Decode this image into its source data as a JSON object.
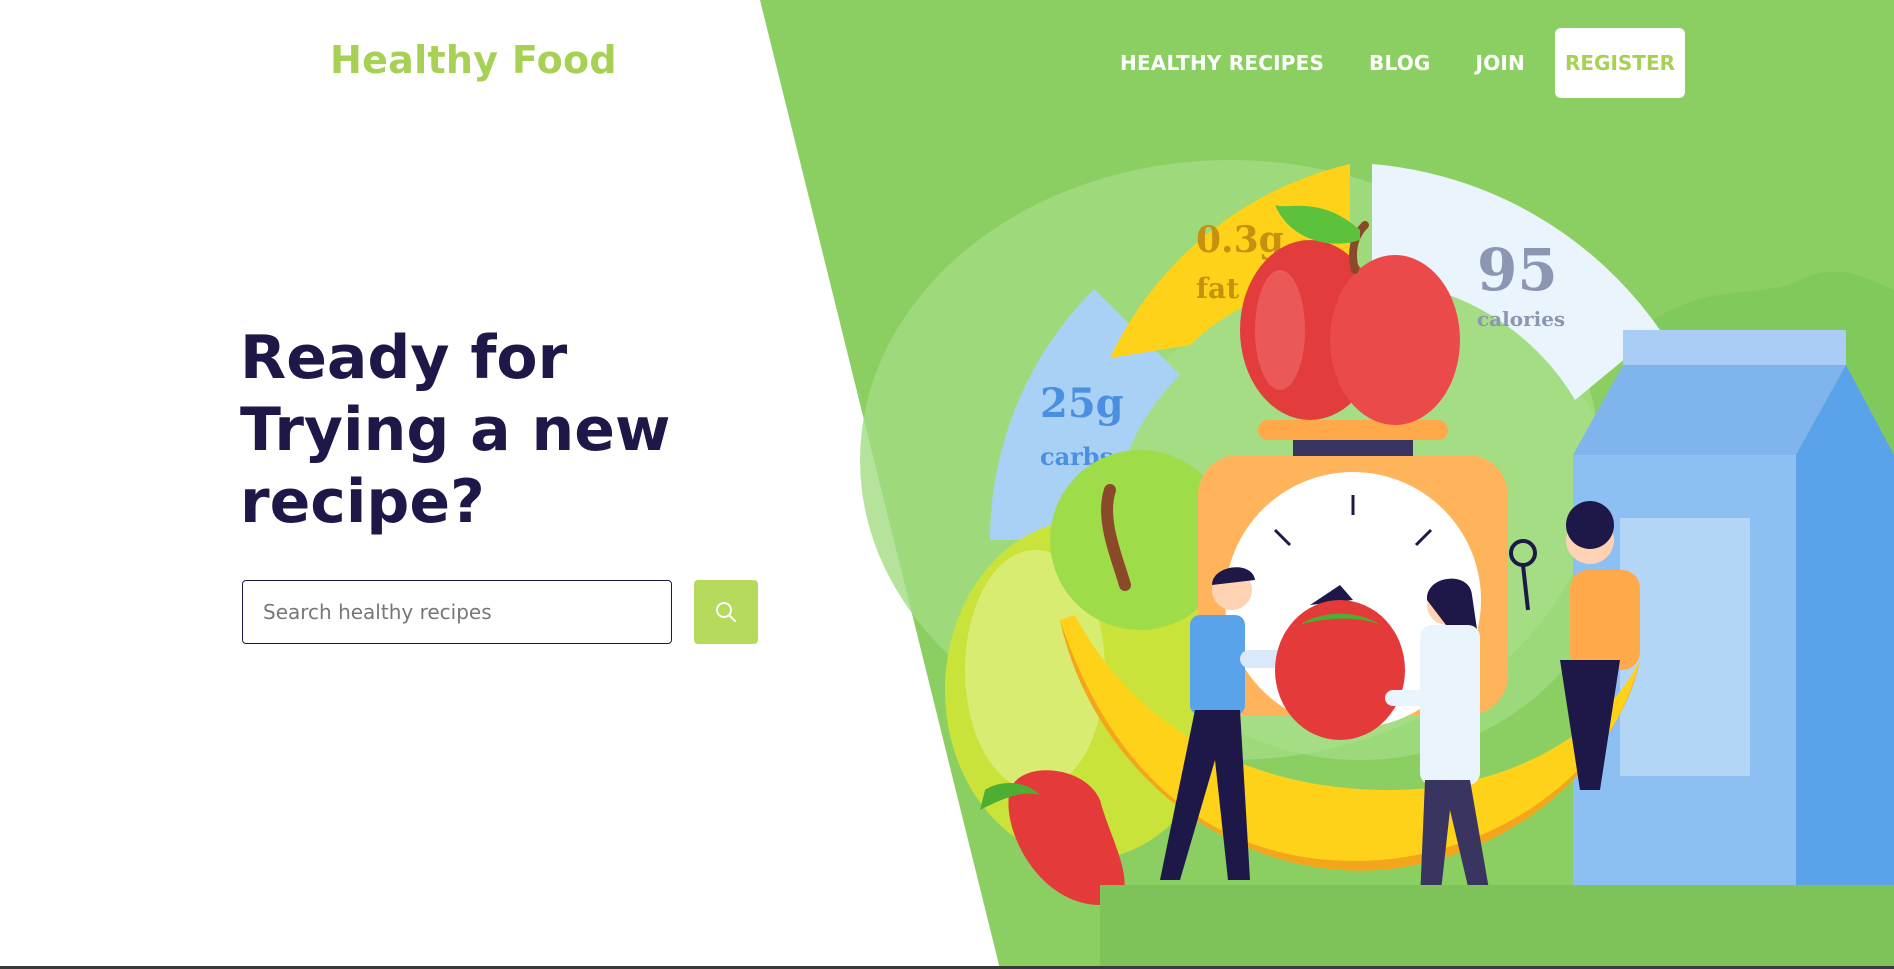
{
  "brand": {
    "name": "Healthy Food"
  },
  "nav": {
    "items": [
      {
        "label": "HEALTHY RECIPES"
      },
      {
        "label": "BLOG"
      },
      {
        "label": "JOIN"
      }
    ],
    "register_label": "REGISTER"
  },
  "hero": {
    "heading_lines": [
      "Ready for",
      "Trying a new",
      "recipe?"
    ],
    "search": {
      "placeholder": "Search healthy recipes",
      "value": ""
    }
  },
  "nutrition": {
    "carbs": {
      "value": "25g",
      "label": "carbs"
    },
    "fat": {
      "value": "0.3g",
      "label": "fat"
    },
    "calories": {
      "value": "95",
      "label": "calories"
    }
  },
  "colors": {
    "brand_green": "#a6d155",
    "hero_green": "#8bcf62",
    "heading_navy": "#1e1848",
    "search_button": "#b6da5c"
  },
  "icons": [
    "search-icon"
  ]
}
